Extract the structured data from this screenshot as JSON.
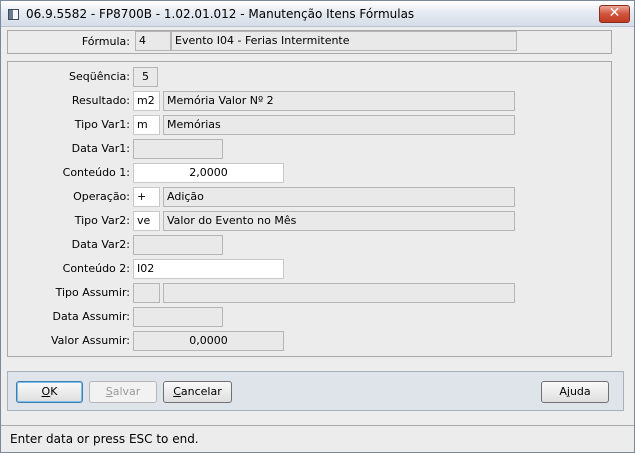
{
  "window": {
    "title": "06.9.5582 - FP8700B - 1.02.01.012 - Manutenção Itens Fórmulas",
    "close_glyph": "✕"
  },
  "header": {
    "formula_label": "Fórmula:",
    "formula_code": "4",
    "formula_desc": "Evento I04 - Ferias Intermitente"
  },
  "form": {
    "sequencia": {
      "label": "Seqüência:",
      "value": "5"
    },
    "resultado": {
      "label": "Resultado:",
      "code": "m2",
      "desc": "Memória Valor Nº 2"
    },
    "tipo_var1": {
      "label": "Tipo Var1:",
      "code": "m",
      "desc": "Memórias"
    },
    "data_var1": {
      "label": "Data Var1:",
      "value": ""
    },
    "conteudo1": {
      "label": "Conteúdo 1:",
      "value": "2,0000"
    },
    "operacao": {
      "label": "Operação:",
      "code": "+",
      "desc": "Adição"
    },
    "tipo_var2": {
      "label": "Tipo Var2:",
      "code": "ve",
      "desc": "Valor do Evento no Mês"
    },
    "data_var2": {
      "label": "Data Var2:",
      "value": ""
    },
    "conteudo2": {
      "label": "Conteúdo 2:",
      "value": "I02"
    },
    "tipo_assumir": {
      "label": "Tipo Assumir:",
      "code": "",
      "desc": ""
    },
    "data_assumir": {
      "label": "Data Assumir:",
      "value": ""
    },
    "valor_assumir": {
      "label": "Valor Assumir:",
      "value": "0,0000"
    }
  },
  "buttons": {
    "ok": {
      "hot": "O",
      "rest": "K"
    },
    "salvar": {
      "hot": "S",
      "rest": "alvar"
    },
    "cancelar": {
      "hot": "C",
      "rest": "ancelar"
    },
    "ajuda": {
      "pre": "A",
      "hot": "j",
      "rest": "uda"
    }
  },
  "status": {
    "text": "Enter data or press ESC to end."
  }
}
